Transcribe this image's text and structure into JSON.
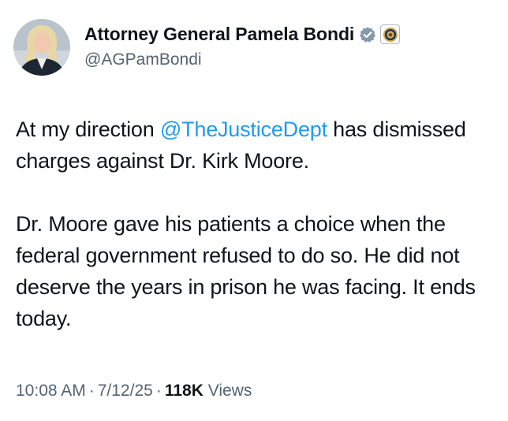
{
  "author": {
    "display_name": "Attorney General Pamela Bondi",
    "handle": "@AGPamBondi",
    "verified_badge_icon": "verified-badge-icon",
    "affiliate_icon": "doj-seal-icon",
    "badge_color": "#829aab"
  },
  "tweet": {
    "p1_pre": "At my direction ",
    "mention": "@TheJusticeDept",
    "p1_post": " has dismissed charges against Dr. Kirk Moore.",
    "p2": "Dr. Moore gave his patients a choice when the federal government refused to do so. He did not deserve the years in prison he was facing. It ends today."
  },
  "meta": {
    "time": "10:08 AM",
    "sep1": "·",
    "date": "7/12/25",
    "sep2": "·",
    "views_count": "118K",
    "views_label": "Views"
  },
  "colors": {
    "text": "#0f1419",
    "secondary": "#536471",
    "link": "#1d9bf0"
  }
}
